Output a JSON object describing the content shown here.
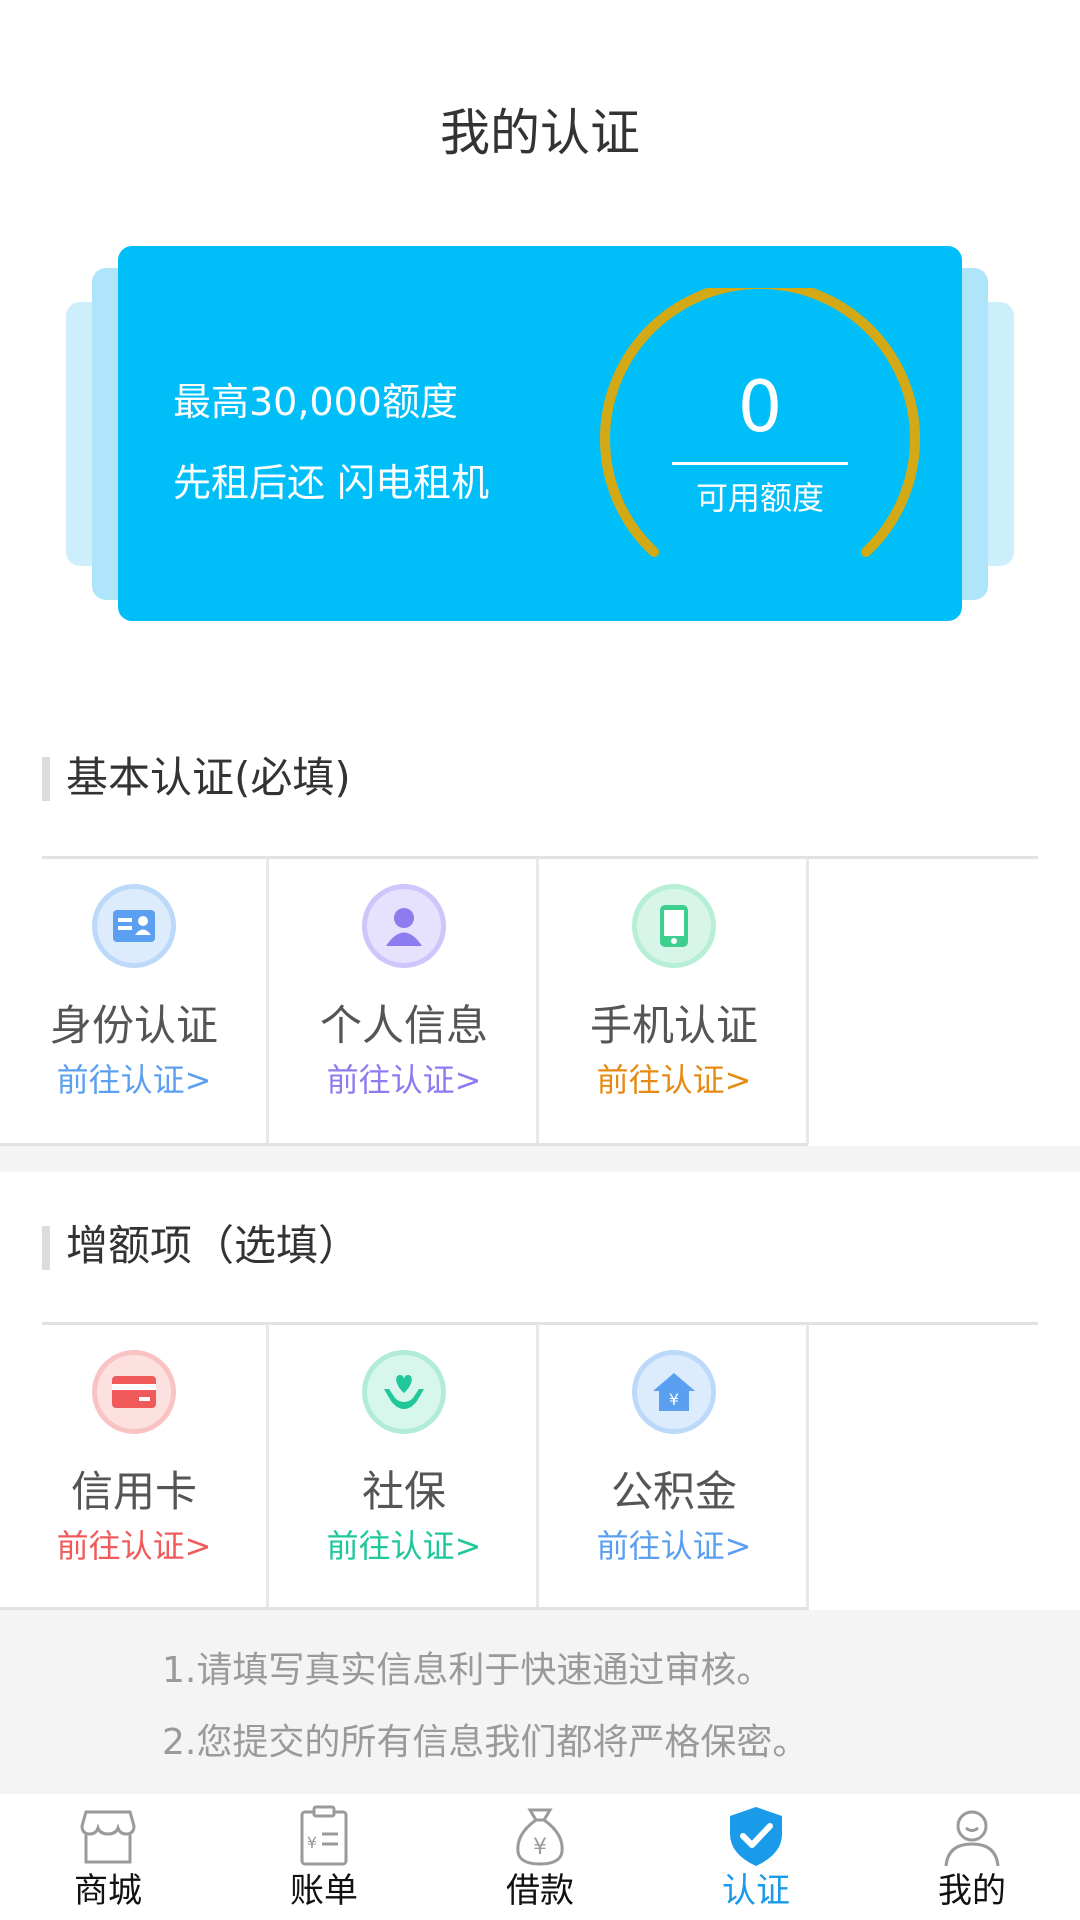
{
  "header": {
    "title": "我的认证"
  },
  "card": {
    "line1": "最高30,000额度",
    "line2": "先租后还 闪电租机",
    "gauge_value": "0",
    "gauge_label": "可用额度",
    "gauge_fill_fraction": 0,
    "background": "#00bff8",
    "arc_color": "#d4a916"
  },
  "basic": {
    "title": "基本认证(必填)",
    "items": [
      {
        "name": "身份认证",
        "link": "前往认证>",
        "icon": "id-card-icon",
        "color": "#5b9ff0"
      },
      {
        "name": "个人信息",
        "link": "前往认证>",
        "icon": "person-icon",
        "color": "#8c7cf0"
      },
      {
        "name": "手机认证",
        "link": "前往认证>",
        "icon": "phone-icon",
        "color": "#e78a12"
      }
    ]
  },
  "extra": {
    "title": "增额项（选填）",
    "items": [
      {
        "name": "信用卡",
        "link": "前往认证>",
        "icon": "credit-card-icon",
        "color": "#f05a5a"
      },
      {
        "name": "社保",
        "link": "前往认证>",
        "icon": "social-security-icon",
        "color": "#1fc79a"
      },
      {
        "name": "公积金",
        "link": "前往认证>",
        "icon": "housing-fund-icon",
        "color": "#5b9ff0"
      }
    ]
  },
  "notes": [
    "1.请填写真实信息利于快速通过审核。",
    "2.您提交的所有信息我们都将严格保密。"
  ],
  "tabs": [
    {
      "label": "商城",
      "icon": "store-icon",
      "active": false
    },
    {
      "label": "账单",
      "icon": "bill-icon",
      "active": false
    },
    {
      "label": "借款",
      "icon": "money-bag-icon",
      "active": false
    },
    {
      "label": "认证",
      "icon": "shield-check-icon",
      "active": true
    },
    {
      "label": "我的",
      "icon": "user-icon",
      "active": false
    }
  ],
  "colors": {
    "accent": "#1a9bea",
    "card": "#00bff8"
  }
}
